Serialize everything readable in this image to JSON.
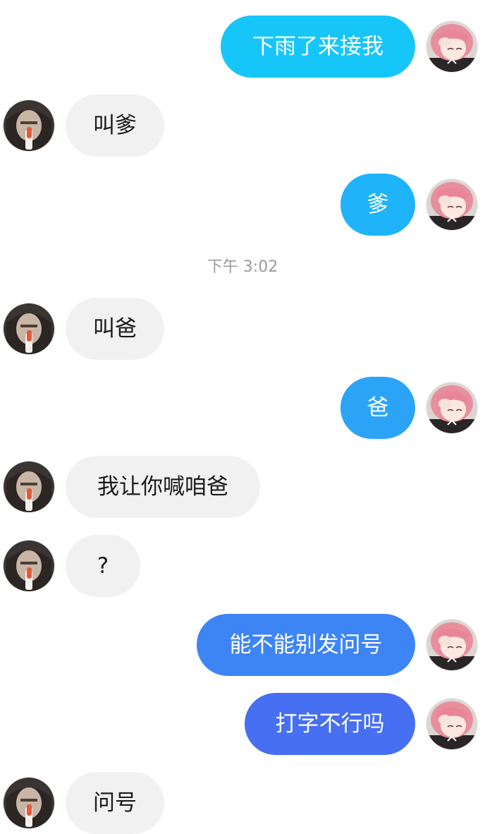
{
  "messages": [
    {
      "side": "out",
      "text": "下雨了来接我",
      "color": "#17c6f9"
    },
    {
      "side": "in",
      "text": "叫爹"
    },
    {
      "side": "out",
      "text": "爹",
      "color": "#1fb3fa"
    },
    {
      "side": "in",
      "text": "叫爸"
    },
    {
      "side": "out",
      "text": "爸",
      "color": "#2ba4f7"
    },
    {
      "side": "in",
      "text": "我让你喊咱爸"
    },
    {
      "side": "in",
      "text": "?"
    },
    {
      "side": "out",
      "text": "能不能别发问号",
      "color": "#3d85f5"
    },
    {
      "side": "out",
      "text": "打字不行吗",
      "color": "#476ff2"
    },
    {
      "side": "in",
      "text": "问号"
    }
  ],
  "timestamp_mid": "下午 3:02",
  "colors": {
    "incoming_bubble": "#f1f1f1",
    "incoming_text": "#1b1b1b",
    "outgoing_text": "#ffffff",
    "timestamp_text": "#9a9a9a"
  },
  "avatars": {
    "self": "pink-hair-anime-avatar-icon",
    "other": "dark-hair-person-avatar-icon"
  }
}
